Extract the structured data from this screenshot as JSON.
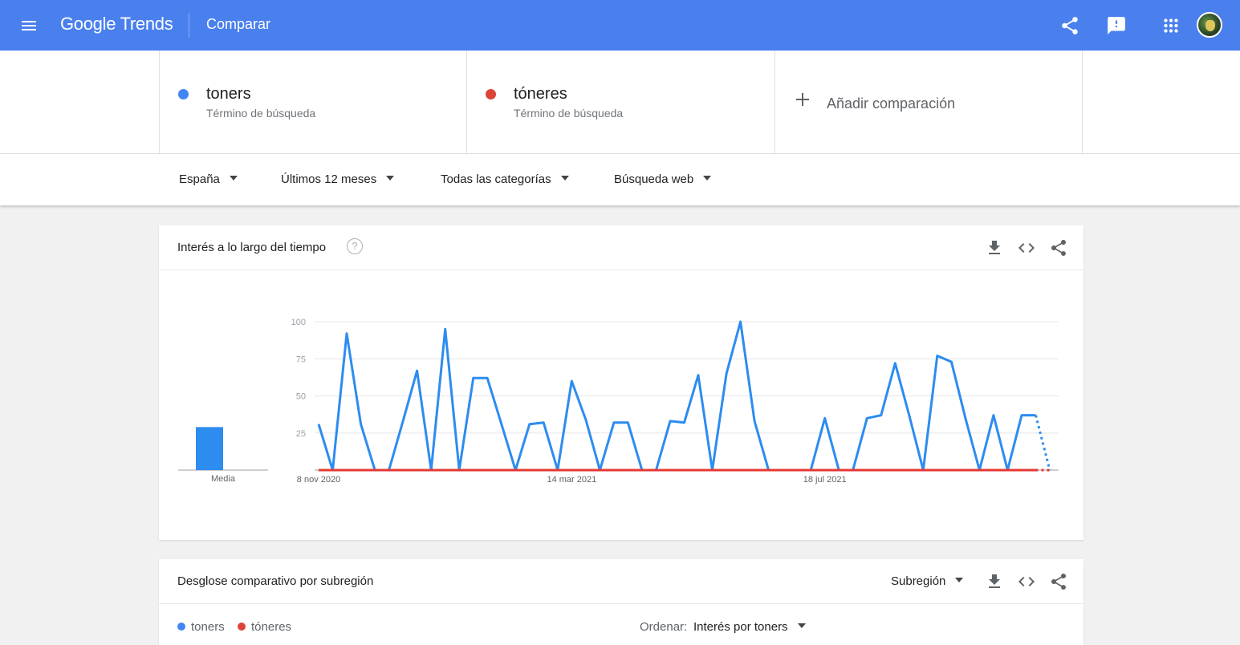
{
  "header": {
    "logo_google": "Google",
    "logo_trends": "Trends",
    "title": "Comparar",
    "icons": [
      "menu-icon",
      "share-icon",
      "feedback-icon",
      "apps-icon",
      "avatar"
    ],
    "bg_color": "#4a80ee"
  },
  "terms": [
    {
      "name": "toners",
      "sub": "Término de búsqueda",
      "color": "#4285f4"
    },
    {
      "name": "tóneres",
      "sub": "Término de búsqueda",
      "color": "#db4437"
    }
  ],
  "add_comparison": "Añadir comparación",
  "filters": {
    "region": "España",
    "period": "Últimos 12 meses",
    "category": "Todas las categorías",
    "search_type": "Búsqueda web"
  },
  "interest_card": {
    "title": "Interés a lo largo del tiempo",
    "help": "?",
    "tools": [
      "download-icon",
      "embed-icon",
      "share-icon"
    ]
  },
  "chart_data": {
    "type": "line",
    "ylim": [
      0,
      100
    ],
    "yticks": [
      "100",
      "75",
      "50",
      "25"
    ],
    "x_tick_labels": [
      "8 nov 2020",
      "14 mar 2021",
      "18 jul 2021"
    ],
    "x_tick_indices": [
      0,
      18,
      36
    ],
    "average_label": "Media",
    "averages": [
      29,
      0
    ],
    "partial_last_point": true,
    "series": [
      {
        "color": "#2d8cf0",
        "values": [
          31,
          0,
          92,
          31,
          0,
          0,
          33,
          67,
          0,
          95,
          0,
          62,
          62,
          31,
          0,
          31,
          32,
          0,
          60,
          34,
          0,
          32,
          32,
          0,
          0,
          33,
          32,
          64,
          0,
          65,
          100,
          33,
          0,
          0,
          0,
          0,
          35,
          0,
          0,
          35,
          37,
          72,
          37,
          0,
          77,
          73,
          35,
          0,
          37,
          0,
          37,
          37,
          0
        ]
      },
      {
        "color": "#e53935",
        "values": [
          0,
          0,
          0,
          0,
          0,
          0,
          0,
          0,
          0,
          0,
          0,
          0,
          0,
          0,
          0,
          0,
          0,
          0,
          0,
          0,
          0,
          0,
          0,
          0,
          0,
          0,
          0,
          0,
          0,
          0,
          0,
          0,
          0,
          0,
          0,
          0,
          0,
          0,
          0,
          0,
          0,
          0,
          0,
          0,
          0,
          0,
          0,
          0,
          0,
          0,
          0,
          0,
          0
        ]
      }
    ]
  },
  "subregion_card": {
    "title": "Desglose comparativo por subregión",
    "selector": "Subregión",
    "tools": [
      "download-icon",
      "embed-icon",
      "share-icon"
    ],
    "legend": [
      "toners",
      "tóneres"
    ],
    "sort_label": "Ordenar:",
    "sort_value": "Interés por toners"
  }
}
